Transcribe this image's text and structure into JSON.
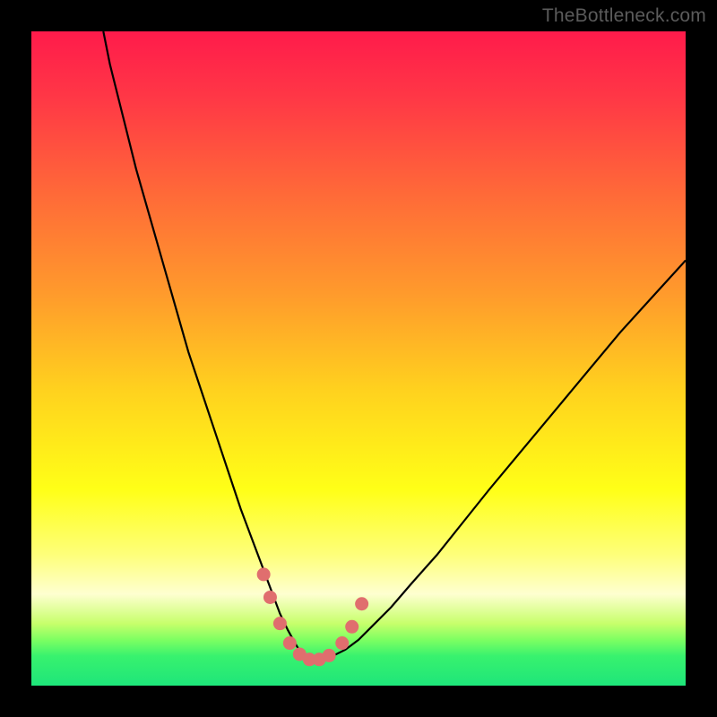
{
  "watermark": {
    "text": "TheBottleneck.com"
  },
  "chart_data": {
    "type": "line",
    "title": "",
    "xlabel": "",
    "ylabel": "",
    "xlim": [
      0,
      100
    ],
    "ylim": [
      0,
      100
    ],
    "grid": false,
    "legend": false,
    "background_gradient_stops": [
      {
        "offset": 0.0,
        "color": "#ff1b4b"
      },
      {
        "offset": 0.1,
        "color": "#ff3746"
      },
      {
        "offset": 0.25,
        "color": "#ff6a38"
      },
      {
        "offset": 0.4,
        "color": "#ff9a2c"
      },
      {
        "offset": 0.55,
        "color": "#ffd21e"
      },
      {
        "offset": 0.7,
        "color": "#ffff17"
      },
      {
        "offset": 0.8,
        "color": "#feff7a"
      },
      {
        "offset": 0.86,
        "color": "#feffd0"
      },
      {
        "offset": 0.905,
        "color": "#c7ff6b"
      },
      {
        "offset": 0.93,
        "color": "#7dff62"
      },
      {
        "offset": 0.955,
        "color": "#38f26e"
      },
      {
        "offset": 1.0,
        "color": "#1ee57a"
      }
    ],
    "series": [
      {
        "name": "bottleneck-curve",
        "color": "#000000",
        "width": 2.2,
        "x": [
          11,
          12,
          14,
          16,
          18,
          20,
          22,
          24,
          26,
          28,
          30,
          32,
          33.5,
          35,
          36.5,
          38,
          39.2,
          40.3,
          41.2,
          42,
          43,
          44.5,
          46,
          48,
          50,
          52,
          55,
          58,
          62,
          66,
          70,
          75,
          80,
          85,
          90,
          95,
          100
        ],
        "y": [
          100,
          95,
          87,
          79,
          72,
          65,
          58,
          51,
          45,
          39,
          33,
          27,
          23,
          19,
          15,
          11,
          8.5,
          6.5,
          5,
          4.2,
          4,
          4.1,
          4.5,
          5.5,
          7,
          9,
          12,
          15.5,
          20,
          25,
          30,
          36,
          42,
          48,
          54,
          59.5,
          65
        ]
      }
    ],
    "markers": {
      "name": "highlight-points",
      "color": "#e06e6e",
      "radius": 7.5,
      "points": [
        {
          "x": 35.5,
          "y": 17
        },
        {
          "x": 36.5,
          "y": 13.5
        },
        {
          "x": 38.0,
          "y": 9.5
        },
        {
          "x": 39.5,
          "y": 6.5
        },
        {
          "x": 41.0,
          "y": 4.8
        },
        {
          "x": 42.5,
          "y": 4.0
        },
        {
          "x": 44.0,
          "y": 4.0
        },
        {
          "x": 45.5,
          "y": 4.6
        },
        {
          "x": 47.5,
          "y": 6.5
        },
        {
          "x": 49.0,
          "y": 9.0
        },
        {
          "x": 50.5,
          "y": 12.5
        }
      ]
    }
  }
}
